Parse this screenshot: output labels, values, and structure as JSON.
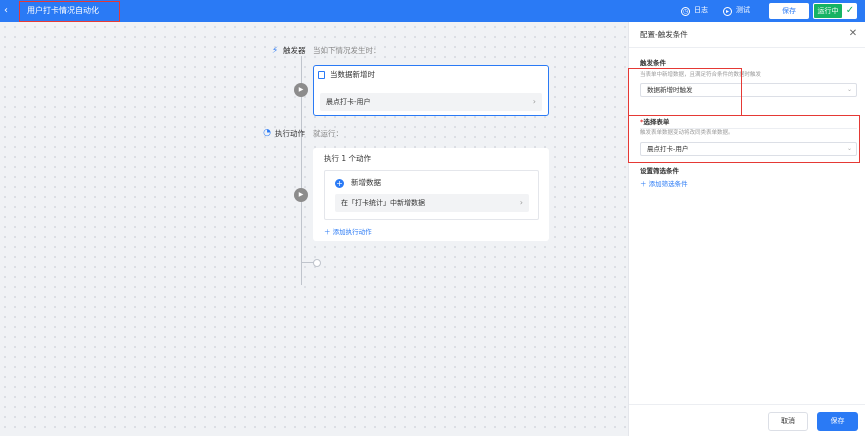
{
  "header": {
    "back_icon": "chevron-left-icon",
    "title": "用户打卡情况自动化",
    "log_label": "日志",
    "test_label": "测试",
    "save_label": "保存",
    "status_label": "运行中",
    "status_icon": "check-icon",
    "accent": "#2a7af5",
    "status_color": "#16b364"
  },
  "flow": {
    "trigger": {
      "icon": "trigger-icon",
      "label": "触发器",
      "condition": "当如下情况发生时：",
      "card_title": "当数据新增时",
      "card_value": "晨点打卡-用户"
    },
    "action": {
      "icon": "action-icon",
      "label": "执行动作",
      "condition": "就运行：",
      "card_title": "执行 1 个动作",
      "item_title": "新增数据",
      "item_value": "在「打卡统计」中新增数据",
      "add_label": "添加执行动作"
    }
  },
  "panel": {
    "title": "配置-触发条件",
    "trigger_section_title": "触发条件",
    "trigger_section_desc": "当表单中新增数据，且满足符合条件的数据时触发",
    "trigger_select_value": "数据新增时触发",
    "form_section_required": "*",
    "form_section_title": "选择表单",
    "form_section_desc": "触发表单数据变动将改同类表单数据。",
    "form_select_value": "晨点打卡-用户",
    "filter_section_title": "设置筛选条件",
    "add_filter_label": "添加筛选条件",
    "cancel_label": "取消",
    "save_label": "保存"
  }
}
